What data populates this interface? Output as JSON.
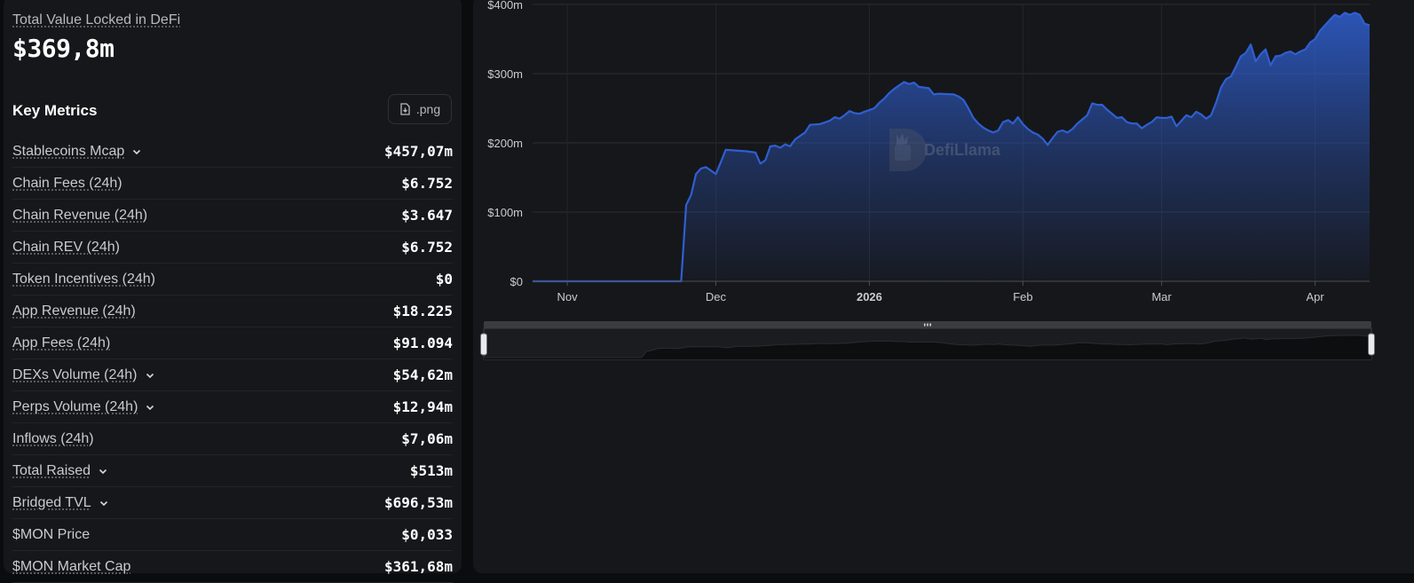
{
  "overview": {
    "tvl_label": "Total Value Locked in DeFi",
    "tvl_value": "$369,8m"
  },
  "key_metrics": {
    "title": "Key Metrics",
    "export_button": ".png",
    "items": [
      {
        "label": "Stablecoins Mcap",
        "value": "$457,07m",
        "expandable": true,
        "dotted": true
      },
      {
        "label": "Chain Fees (24h)",
        "value": "$6.752",
        "expandable": false,
        "dotted": true
      },
      {
        "label": "Chain Revenue (24h)",
        "value": "$3.647",
        "expandable": false,
        "dotted": true
      },
      {
        "label": "Chain REV (24h)",
        "value": "$6.752",
        "expandable": false,
        "dotted": true
      },
      {
        "label": "Token Incentives (24h)",
        "value": "$0",
        "expandable": false,
        "dotted": true
      },
      {
        "label": "App Revenue (24h)",
        "value": "$18.225",
        "expandable": false,
        "dotted": true
      },
      {
        "label": "App Fees (24h)",
        "value": "$91.094",
        "expandable": false,
        "dotted": true
      },
      {
        "label": "DEXs Volume (24h)",
        "value": "$54,62m",
        "expandable": true,
        "dotted": true
      },
      {
        "label": "Perps Volume (24h)",
        "value": "$12,94m",
        "expandable": true,
        "dotted": true
      },
      {
        "label": "Inflows (24h)",
        "value": "$7,06m",
        "expandable": false,
        "dotted": true
      },
      {
        "label": "Total Raised",
        "value": "$513m",
        "expandable": true,
        "dotted": true
      },
      {
        "label": "Bridged TVL",
        "value": "$696,53m",
        "expandable": true,
        "dotted": true
      },
      {
        "label": "$MON Price",
        "value": "$0,033",
        "expandable": false,
        "dotted": false
      },
      {
        "label": "$MON Market Cap",
        "value": "$361,68m",
        "expandable": false,
        "dotted": true
      }
    ]
  },
  "chart_data": {
    "type": "area",
    "watermark": "DefiLlama",
    "color": "#2f5fd0",
    "y_ticks": [
      "$0",
      "$100m",
      "$200m",
      "$300m",
      "$400m"
    ],
    "ylim": [
      0,
      400
    ],
    "x_ticks": [
      {
        "label": "Nov",
        "day": 0,
        "bold": false
      },
      {
        "label": "Dec",
        "day": 30,
        "bold": false
      },
      {
        "label": "2026",
        "day": 61,
        "bold": true
      },
      {
        "label": "Feb",
        "day": 92,
        "bold": false
      },
      {
        "label": "Mar",
        "day": 120,
        "bold": false
      },
      {
        "label": "Apr",
        "day": 151,
        "bold": false
      }
    ],
    "x_range_days": [
      -7,
      162
    ],
    "points": [
      [
        -7,
        0
      ],
      [
        23,
        0
      ],
      [
        24,
        110
      ],
      [
        25,
        125
      ],
      [
        26,
        155
      ],
      [
        27,
        163
      ],
      [
        28,
        165
      ],
      [
        29,
        160
      ],
      [
        30,
        155
      ],
      [
        31,
        172
      ],
      [
        32,
        190
      ],
      [
        34,
        189
      ],
      [
        36,
        188
      ],
      [
        38,
        186
      ],
      [
        39,
        170
      ],
      [
        40,
        175
      ],
      [
        41,
        195
      ],
      [
        42,
        196
      ],
      [
        43,
        193
      ],
      [
        44,
        198
      ],
      [
        45,
        195
      ],
      [
        46,
        205
      ],
      [
        47,
        210
      ],
      [
        48,
        215
      ],
      [
        49,
        226
      ],
      [
        51,
        227
      ],
      [
        53,
        232
      ],
      [
        54,
        237
      ],
      [
        55,
        235
      ],
      [
        56,
        240
      ],
      [
        57,
        246
      ],
      [
        58,
        243
      ],
      [
        59,
        242
      ],
      [
        60,
        245
      ],
      [
        62,
        250
      ],
      [
        63,
        258
      ],
      [
        64,
        264
      ],
      [
        65,
        272
      ],
      [
        66,
        278
      ],
      [
        68,
        288
      ],
      [
        69,
        285
      ],
      [
        70,
        287
      ],
      [
        71,
        281
      ],
      [
        73,
        279
      ],
      [
        74,
        270
      ],
      [
        75,
        271
      ],
      [
        78,
        270
      ],
      [
        79,
        267
      ],
      [
        80,
        262
      ],
      [
        81,
        250
      ],
      [
        82,
        236
      ],
      [
        83,
        228
      ],
      [
        84,
        222
      ],
      [
        85,
        218
      ],
      [
        86,
        215
      ],
      [
        87,
        218
      ],
      [
        88,
        230
      ],
      [
        89,
        233
      ],
      [
        90,
        228
      ],
      [
        91,
        237
      ],
      [
        92,
        227
      ],
      [
        93,
        220
      ],
      [
        94,
        215
      ],
      [
        95,
        212
      ],
      [
        96,
        206
      ],
      [
        97,
        197
      ],
      [
        98,
        207
      ],
      [
        99,
        216
      ],
      [
        100,
        218
      ],
      [
        101,
        215
      ],
      [
        102,
        220
      ],
      [
        103,
        228
      ],
      [
        104,
        234
      ],
      [
        105,
        240
      ],
      [
        106,
        257
      ],
      [
        107,
        255
      ],
      [
        108,
        255
      ],
      [
        109,
        248
      ],
      [
        110,
        242
      ],
      [
        111,
        236
      ],
      [
        112,
        237
      ],
      [
        113,
        230
      ],
      [
        114,
        228
      ],
      [
        115,
        228
      ],
      [
        116,
        221
      ],
      [
        117,
        226
      ],
      [
        118,
        230
      ],
      [
        119,
        237
      ],
      [
        120,
        236
      ],
      [
        121,
        236
      ],
      [
        122,
        238
      ],
      [
        123,
        224
      ],
      [
        124,
        232
      ],
      [
        125,
        240
      ],
      [
        126,
        237
      ],
      [
        127,
        245
      ],
      [
        128,
        241
      ],
      [
        129,
        235
      ],
      [
        130,
        240
      ],
      [
        131,
        258
      ],
      [
        132,
        280
      ],
      [
        133,
        292
      ],
      [
        134,
        296
      ],
      [
        135,
        310
      ],
      [
        136,
        325
      ],
      [
        137,
        330
      ],
      [
        138,
        342
      ],
      [
        139,
        318
      ],
      [
        140,
        328
      ],
      [
        141,
        335
      ],
      [
        142,
        312
      ],
      [
        143,
        325
      ],
      [
        144,
        326
      ],
      [
        145,
        330
      ],
      [
        146,
        332
      ],
      [
        147,
        328
      ],
      [
        148,
        332
      ],
      [
        149,
        335
      ],
      [
        150,
        345
      ],
      [
        151,
        350
      ],
      [
        152,
        362
      ],
      [
        153,
        370
      ],
      [
        154,
        378
      ],
      [
        155,
        385
      ],
      [
        156,
        382
      ],
      [
        157,
        388
      ],
      [
        158,
        385
      ],
      [
        159,
        388
      ],
      [
        160,
        385
      ],
      [
        161,
        372
      ],
      [
        162,
        370
      ]
    ]
  }
}
